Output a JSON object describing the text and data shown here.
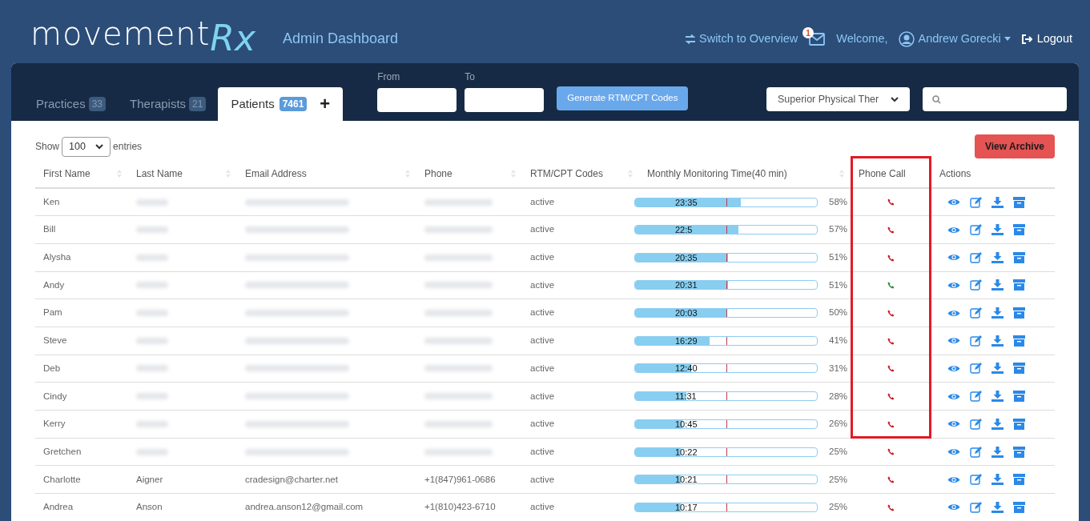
{
  "header": {
    "logo_main": "movement",
    "logo_accent": "Rx",
    "title": "Admin Dashboard",
    "switch_link": "Switch to Overview",
    "messages_badge": "1",
    "welcome": "Welcome,",
    "user": "Andrew Gorecki",
    "logout": "Logout"
  },
  "tabs": [
    {
      "label": "Practices",
      "count": "33",
      "selected": false
    },
    {
      "label": "Therapists",
      "count": "21",
      "selected": false
    },
    {
      "label": "Patients",
      "count": "7461",
      "selected": true,
      "add": "+"
    }
  ],
  "filters": {
    "from_label": "From",
    "to_label": "To",
    "generate_button": "Generate RTM/CPT Codes",
    "practice_select": "Superior Physical Ther"
  },
  "table_controls": {
    "show": "Show",
    "entries_value": "100",
    "entries": "entries",
    "archive_button": "View Archive"
  },
  "columns": [
    {
      "label": "First Name",
      "sortable": true,
      "highlighted": false
    },
    {
      "label": "Last Name",
      "sortable": true,
      "highlighted": false
    },
    {
      "label": "Email Address",
      "sortable": true,
      "highlighted": false
    },
    {
      "label": "Phone",
      "sortable": true,
      "highlighted": false
    },
    {
      "label": "RTM/CPT Codes",
      "sortable": true,
      "highlighted": false
    },
    {
      "label": "Monthly Monitoring Time(40 min)",
      "sortable": true,
      "highlighted": false
    },
    {
      "label": "Phone Call",
      "sortable": false,
      "highlighted": true
    },
    {
      "label": "Actions",
      "sortable": false,
      "highlighted": false
    }
  ],
  "rows": [
    {
      "first": "Ken",
      "redacted": true,
      "status": "active",
      "time": "23:35",
      "level": 0.58,
      "percent": "58%",
      "called": false
    },
    {
      "first": "Bill",
      "redacted": true,
      "status": "active",
      "time": "22:5",
      "level": 0.57,
      "percent": "57%",
      "called": false
    },
    {
      "first": "Alysha",
      "redacted": true,
      "status": "active",
      "time": "20:35",
      "level": 0.51,
      "percent": "51%",
      "called": false
    },
    {
      "first": "Andy",
      "redacted": true,
      "status": "active",
      "time": "20:31",
      "level": 0.51,
      "percent": "51%",
      "called": true
    },
    {
      "first": "Pam",
      "redacted": true,
      "status": "active",
      "time": "20:03",
      "level": 0.5,
      "percent": "50%",
      "called": false
    },
    {
      "first": "Steve",
      "redacted": true,
      "status": "active",
      "time": "16:29",
      "level": 0.41,
      "percent": "41%",
      "called": false
    },
    {
      "first": "Deb",
      "redacted": true,
      "status": "active",
      "time": "12:40",
      "level": 0.31,
      "percent": "31%",
      "called": false
    },
    {
      "first": "Cindy",
      "redacted": true,
      "status": "active",
      "time": "11:31",
      "level": 0.28,
      "percent": "28%",
      "called": false
    },
    {
      "first": "Kerry",
      "redacted": true,
      "status": "active",
      "time": "10:45",
      "level": 0.26,
      "percent": "26%",
      "called": false
    },
    {
      "first": "Gretchen",
      "redacted": true,
      "status": "active",
      "time": "10:22",
      "level": 0.25,
      "percent": "25%",
      "called": false
    },
    {
      "first": "Charlotte",
      "last": "Aigner",
      "email": "cradesign@charter.net",
      "phone": "+1(847)961-0686",
      "redacted": false,
      "status": "active",
      "time": "10:21",
      "level": 0.25,
      "percent": "25%",
      "called": false
    },
    {
      "first": "Andrea",
      "last": "Anson",
      "email": "andrea.anson12@gmail.com",
      "phone": "+1(810)423-6710",
      "redacted": false,
      "status": "active",
      "time": "10:17",
      "level": 0.25,
      "percent": "25%",
      "called": false
    }
  ]
}
